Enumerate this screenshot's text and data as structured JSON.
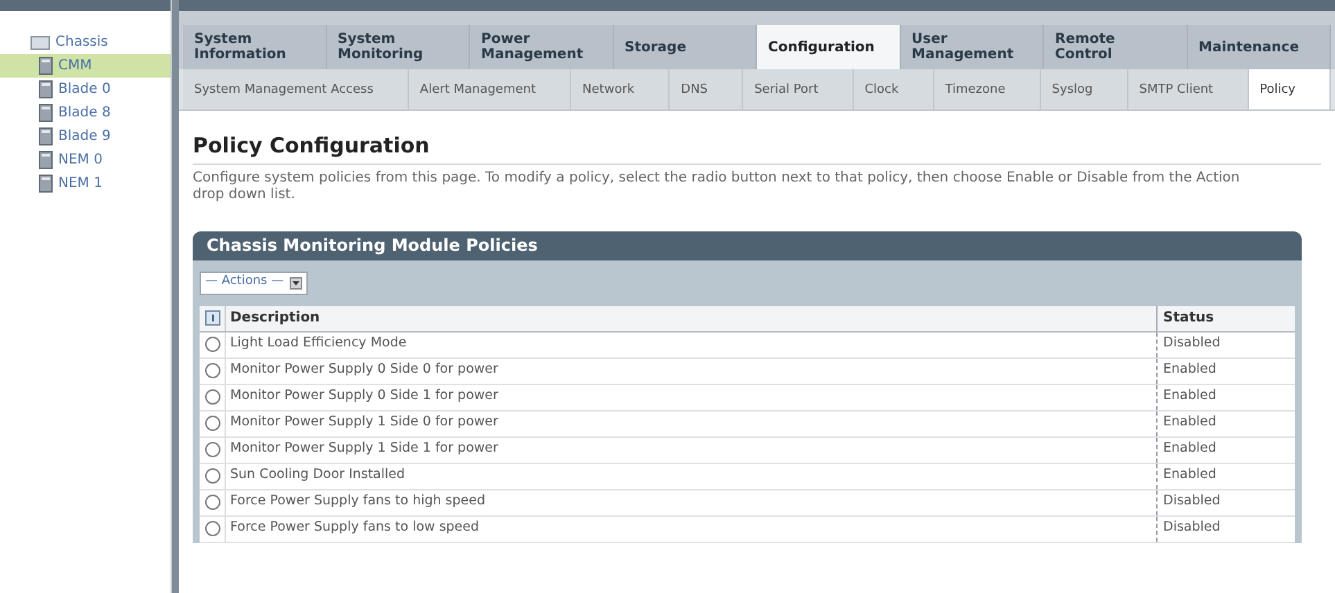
{
  "sidebar": {
    "items": [
      {
        "label": "Chassis",
        "selected": false,
        "children": [
          {
            "label": "CMM",
            "selected": true
          },
          {
            "label": "Blade 0",
            "selected": false
          },
          {
            "label": "Blade 8",
            "selected": false
          },
          {
            "label": "Blade 9",
            "selected": false
          },
          {
            "label": "NEM 0",
            "selected": false
          },
          {
            "label": "NEM 1",
            "selected": false
          }
        ]
      }
    ]
  },
  "tabs": [
    {
      "label": "System Information",
      "selected": false
    },
    {
      "label": "System Monitoring",
      "selected": false
    },
    {
      "label": "Power Management",
      "selected": false
    },
    {
      "label": "Storage",
      "selected": false
    },
    {
      "label": "Configuration",
      "selected": true
    },
    {
      "label": "User Management",
      "selected": false
    },
    {
      "label": "Remote Control",
      "selected": false
    },
    {
      "label": "Maintenance",
      "selected": false
    }
  ],
  "subtabs": [
    {
      "label": "System Management Access",
      "selected": false
    },
    {
      "label": "Alert Management",
      "selected": false
    },
    {
      "label": "Network",
      "selected": false
    },
    {
      "label": "DNS",
      "selected": false
    },
    {
      "label": "Serial Port",
      "selected": false
    },
    {
      "label": "Clock",
      "selected": false
    },
    {
      "label": "Timezone",
      "selected": false
    },
    {
      "label": "Syslog",
      "selected": false
    },
    {
      "label": "SMTP Client",
      "selected": false
    },
    {
      "label": "Policy",
      "selected": true
    }
  ],
  "page": {
    "title": "Policy Configuration",
    "description": "Configure system policies from this page. To modify a policy, select the radio button next to that policy, then choose Enable or Disable from the Action drop down list."
  },
  "table": {
    "title": "Chassis Monitoring Module Policies",
    "actions": "— Actions —",
    "columns": [
      "Description",
      "Status"
    ],
    "rows": [
      {
        "description": "Light Load Efficiency Mode",
        "status": "Disabled",
        "selected": false
      },
      {
        "description": "Monitor Power Supply 0 Side 0 for power",
        "status": "Enabled",
        "selected": false
      },
      {
        "description": "Monitor Power Supply 0 Side 1 for power",
        "status": "Enabled",
        "selected": false
      },
      {
        "description": "Monitor Power Supply 1 Side 0 for power",
        "status": "Enabled",
        "selected": false
      },
      {
        "description": "Monitor Power Supply 1 Side 1 for power",
        "status": "Enabled",
        "selected": false
      },
      {
        "description": "Sun Cooling Door Installed",
        "status": "Enabled",
        "selected": false
      },
      {
        "description": "Force Power Supply fans to high speed",
        "status": "Disabled",
        "selected": false
      },
      {
        "description": "Force Power Supply fans to low speed",
        "status": "Disabled",
        "selected": false
      }
    ]
  }
}
